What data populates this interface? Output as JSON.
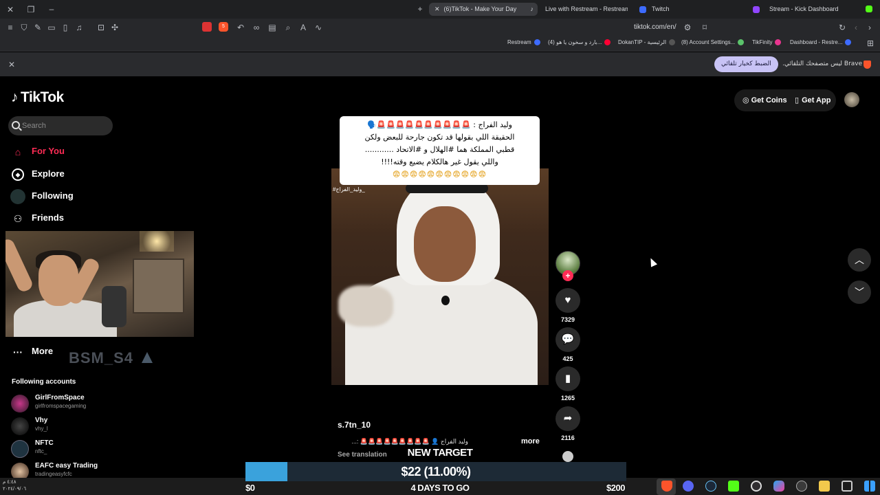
{
  "browser": {
    "tabs": [
      {
        "title": "(6)TikTok - Make Your Day",
        "active": true
      },
      {
        "title": "Live with Restream - Restream",
        "active": false
      },
      {
        "title": "Twitch",
        "active": false
      },
      {
        "title": "Stream - Kick Dashboard",
        "active": false
      }
    ],
    "address": "tiktok.com/en/",
    "bookmarks": [
      "Restream",
      "(4) بارد و سخون يا هو...",
      "DokanTIP - الرئيسية",
      "(8) Account Settings...",
      "TikFinity",
      "Dashboard - Restre..."
    ],
    "shields_count": "5",
    "infobar": {
      "message": "Brave ليس متصفحك التلقائي.",
      "button": "الضبط كخيار تلقائي"
    },
    "colors": {
      "accent": "#fe2c55",
      "chrome_bg": "#27282b",
      "info_button": "#c8c3f5"
    }
  },
  "tiktok": {
    "logo": "TikTok",
    "search_placeholder": "Search",
    "nav": [
      {
        "label": "For You",
        "icon": "home-icon",
        "active": true
      },
      {
        "label": "Explore",
        "icon": "compass-icon",
        "active": false
      },
      {
        "label": "Following",
        "icon": "following-avatar-icon",
        "active": false
      },
      {
        "label": "Friends",
        "icon": "friends-icon",
        "active": false
      },
      {
        "label": "More",
        "icon": "more-dots-icon",
        "active": false
      }
    ],
    "following_header": "Following accounts",
    "accounts": [
      {
        "name": "GirlFromSpace",
        "handle": "girlfromspacegaming"
      },
      {
        "name": "Vhy",
        "handle": "vhy_l"
      },
      {
        "name": "NFTC",
        "handle": "nftc_"
      },
      {
        "name": "EAFC easy Trading",
        "handle": "tradingeasyfcfc"
      }
    ],
    "top": {
      "coins": "Get Coins",
      "app": "Get App"
    },
    "video": {
      "caption_lines": [
        "وليد الفراج :",
        "الحقيقة اللي بقولها قد تكون جارحة للبعض ولكن",
        "قطبي المملكة هما #الهلال و #الاتحاد ............",
        "واللي يقول غير هالكلام يضيع وقته!!!!"
      ],
      "caption_emojis": "🚨🚨🚨🚨🚨🚨🚨🚨🚨🚨🗣️",
      "caption_faces": "😨😨😨😨😨😨😨😨😨😨😨",
      "watermark": "#وليد_الفراج_",
      "username": "s.7tn_10",
      "description": "وليد الفراج 👤 🚨🚨🚨🚨🚨🚨🚨🚨🚨 :...",
      "more": "more",
      "see_translation": "See translation"
    },
    "actions": {
      "likes": "7329",
      "comments": "425",
      "saves": "1265",
      "shares": "2116"
    }
  },
  "stream_overlay": {
    "streamer": "BSM_S4",
    "goal_title": "NEW TARGET",
    "goal_amount": "$22 (11.00%)",
    "goal_progress": 0.11,
    "goal_start": "$0",
    "goal_end": "$200",
    "goal_remaining": "4 DAYS TO GO"
  },
  "taskbar": {
    "time": "٤:٤٨ م",
    "date": "٢٠٢٤/٠٩/٠٦"
  }
}
